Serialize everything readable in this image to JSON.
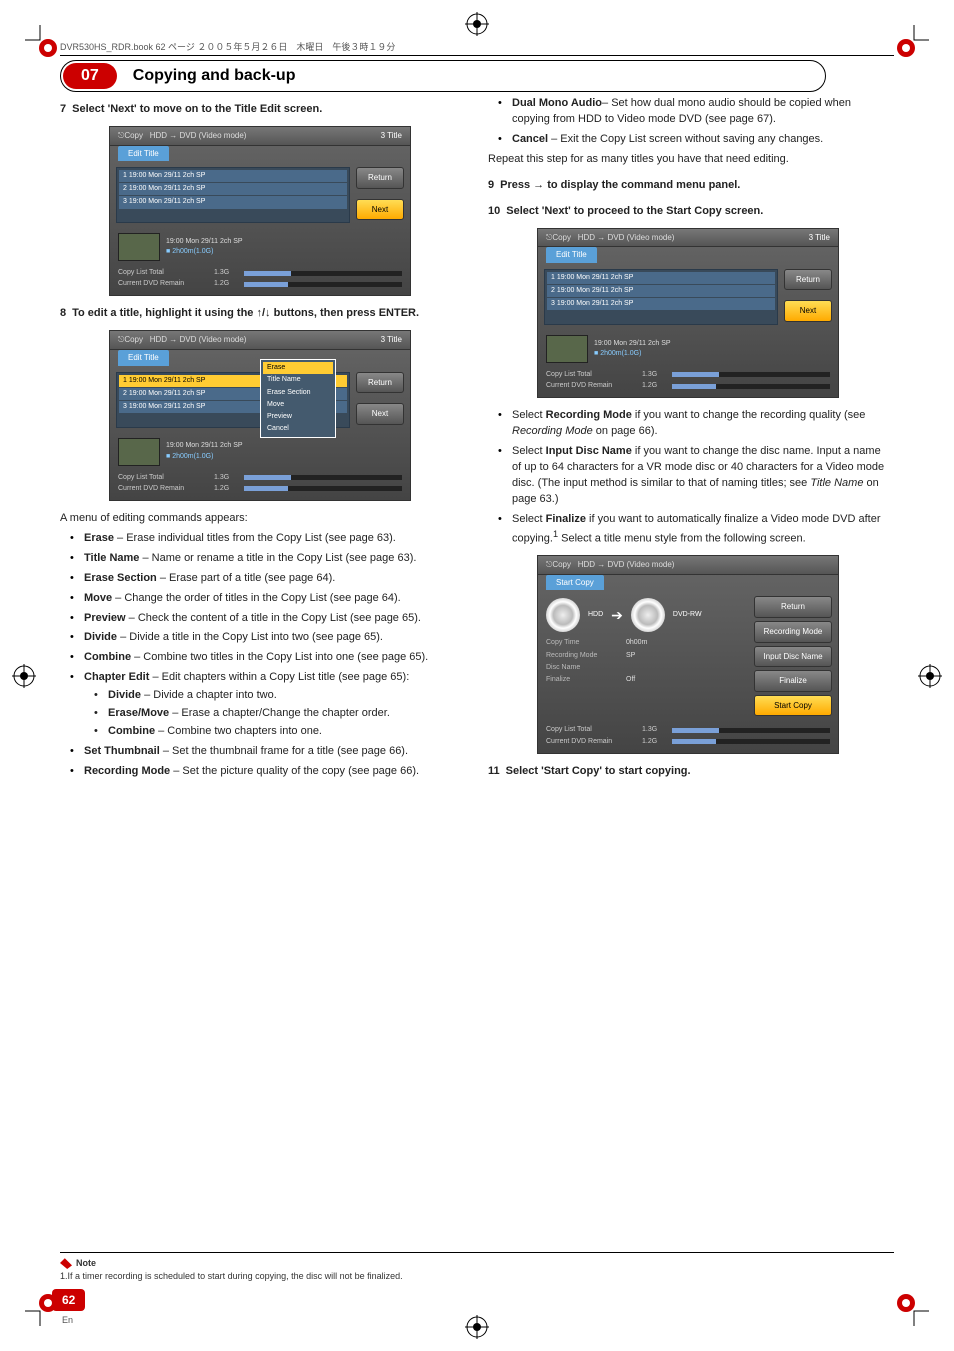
{
  "doc_header": "DVR530HS_RDR.book 62 ページ ２００５年５月２６日　木曜日　午後３時１９分",
  "chapter_number": "07",
  "chapter_title": "Copying and back-up",
  "page_number": "62",
  "page_lang": "En",
  "left": {
    "step7": "Select 'Next' to move on to the Title Edit screen.",
    "step8": "To edit a title, highlight it using the ↑/↓ buttons, then press ENTER.",
    "menu_intro": "A menu of editing commands appears:",
    "items": [
      {
        "name": "Erase",
        "desc": " – Erase individual titles from the Copy List (see page 63)."
      },
      {
        "name": "Title Name",
        "desc": " – Name or rename a title in the Copy List (see page 63)."
      },
      {
        "name": "Erase Section",
        "desc": " – Erase part of a title (see page 64)."
      },
      {
        "name": "Move",
        "desc": " – Change the order of titles in the Copy List (see page 64)."
      },
      {
        "name": "Preview",
        "desc": " – Check the content of a title in the Copy List (see page 65)."
      },
      {
        "name": "Divide",
        "desc": " – Divide a title in the Copy List into two (see page 65)."
      },
      {
        "name": "Combine",
        "desc": " – Combine two titles in the Copy List into one (see page 65)."
      },
      {
        "name": "Chapter Edit",
        "desc": " – Edit chapters within a Copy List title (see page 65):"
      },
      {
        "name": "Set Thumbnail",
        "desc": " – Set the thumbnail frame for a title (see page 66)."
      },
      {
        "name": "Recording Mode",
        "desc": " – Set the picture quality of the copy (see page 66)."
      }
    ],
    "chapter_sub": [
      {
        "name": "Divide",
        "desc": " – Divide a chapter into two."
      },
      {
        "name": "Erase/Move",
        "desc": " – Erase a chapter/Change the chapter order."
      },
      {
        "name": "Combine",
        "desc": " – Combine two chapters into one."
      }
    ]
  },
  "right": {
    "top_items": [
      {
        "name": "Dual Mono Audio",
        "desc": "– Set how dual mono audio should be copied when copying from HDD to Video mode DVD (see page 67)."
      },
      {
        "name": "Cancel",
        "desc": " – Exit the Copy List screen without saving any changes."
      }
    ],
    "repeat_text": "Repeat this step for as many titles you have that need editing.",
    "step9": "Press → to display the command menu panel.",
    "step10": "Select 'Next' to proceed to the Start Copy screen.",
    "after10": [
      {
        "pre": "Select ",
        "name": "Recording Mode",
        "desc": " if you want to change the recording quality (see ",
        "ital": "Recording Mode",
        "tail": " on page 66)."
      },
      {
        "pre": "Select ",
        "name": "Input Disc Name",
        "desc": " if you want to change the disc name. Input a name of up to 64 characters for a VR mode disc or 40 characters for a Video mode disc. (The input method is similar to that of naming titles; see ",
        "ital": "Title Name",
        "tail": " on page 63.)"
      },
      {
        "pre": "Select ",
        "name": "Finalize",
        "desc": " if you want to automatically finalize a Video mode DVD after copying.",
        "sup": "1",
        "tail2": " Select a title menu style from the following screen."
      }
    ],
    "step11": "Select 'Start Copy' to start copying."
  },
  "shot_common": {
    "copy_label": "Copy",
    "mode_label": "HDD → DVD (Video mode)",
    "title_count": "3  Title",
    "edit_tab": "Edit Title",
    "rows": [
      "1   19:00  Mon  29/11   2ch    SP",
      "2   19:00  Mon  29/11   2ch    SP",
      "3   19:00  Mon  29/11   2ch    SP"
    ],
    "thumb_info": "19:00  Mon  29/11    2ch    SP",
    "thumb_dur": "2h00m(1.0G)",
    "copy_list_total": "Copy List Total",
    "dvd_remain": "Current DVD Remain",
    "val_total": "1.3G",
    "val_remain": "1.2G",
    "btn_return": "Return",
    "btn_next": "Next"
  },
  "popup_items": [
    "Erase",
    "Title Name",
    "Erase Section",
    "Move",
    "Preview",
    "Cancel"
  ],
  "start_copy": {
    "tab": "Start Copy",
    "hdd": "HDD",
    "dvd": "DVD-RW",
    "copy_time_lbl": "Copy Time",
    "copy_time_val": "0h00m",
    "rec_mode_lbl": "Recording Mode",
    "rec_mode_val": "SP",
    "disc_name_lbl": "Disc Name",
    "finalize_lbl": "Finalize",
    "finalize_val": "Off",
    "side": [
      "Return",
      "Recording Mode",
      "Input Disc Name",
      "Finalize",
      "Start Copy"
    ]
  },
  "note": {
    "label": "Note",
    "text": "1.If a timer recording is scheduled to start during copying, the disc will not be finalized."
  }
}
